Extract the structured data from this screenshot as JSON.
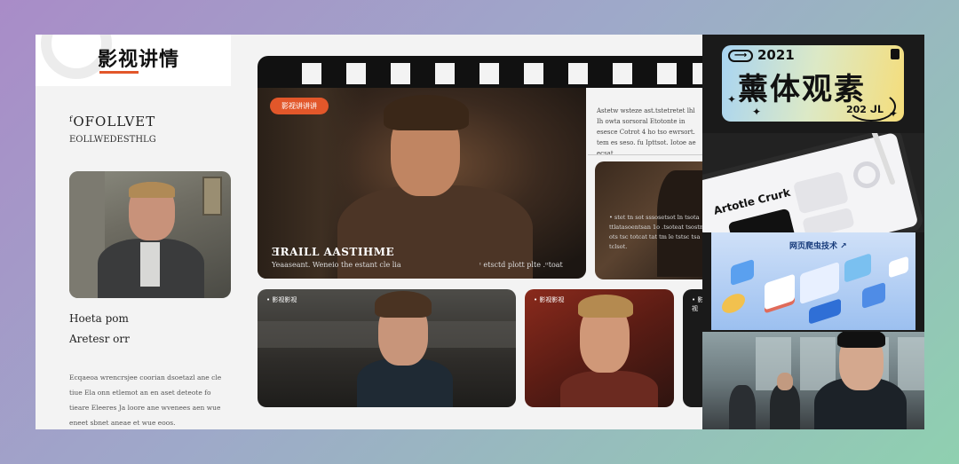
{
  "header": {
    "logo_title": "影视讲情"
  },
  "sidebar": {
    "heading": "ᶠOFOLLVET",
    "subheading": "EOLLWEDESTHLG",
    "label1": "Hoeta pom",
    "label2": "Aretesr orr",
    "paragraph": "Ecqaeoa wrencrsjee coorian dsoetazl ane cle tiue Ela onn etlemot an en aset deteote fo tieare Eleeres Ja loore ane wvenees aen wue eneet sbnet aneae et wue eoos."
  },
  "hero": {
    "badge": "影视讲讲讲",
    "title": "ƎRAILL AASTIHME",
    "caption_left": "Yeaaseant. Weneio the estant cle lia",
    "caption_right": "ᶦ etsctd plott plte .ᶦᶦtoat"
  },
  "top_right_text": "Astetw wsteze ast.tstetretet lhl Ih owta sorsoral Etotonte in esesce Cotrot 4 ho tso ewrsort. tem es seso. fu Ipttsot. Iotoe ae ecsat.",
  "mid_right_text": "• stet tn sot sssosetsot ln tsota ttlatasoentsan 1o .tsoteat tsostn ots tsc totcat tat tm le tstsc tsa tclsot.",
  "cards": [
    {
      "tag": "• 影视影视"
    },
    {
      "tag": "• 影视影视"
    },
    {
      "tag": "• 影视"
    }
  ],
  "right_panels": {
    "p1_arrow": "⟶",
    "p1_year": "2021",
    "p1_title": "薰体观素",
    "p1_year2": "202 ᒍᒪ",
    "p2_title": "Artotle Crurk",
    "p3_title": "网页爬虫技术 ↗"
  },
  "colors": {
    "accent": "#e2572a",
    "background_gradient_start": "#a98cc8",
    "background_gradient_end": "#8fd0b0"
  }
}
